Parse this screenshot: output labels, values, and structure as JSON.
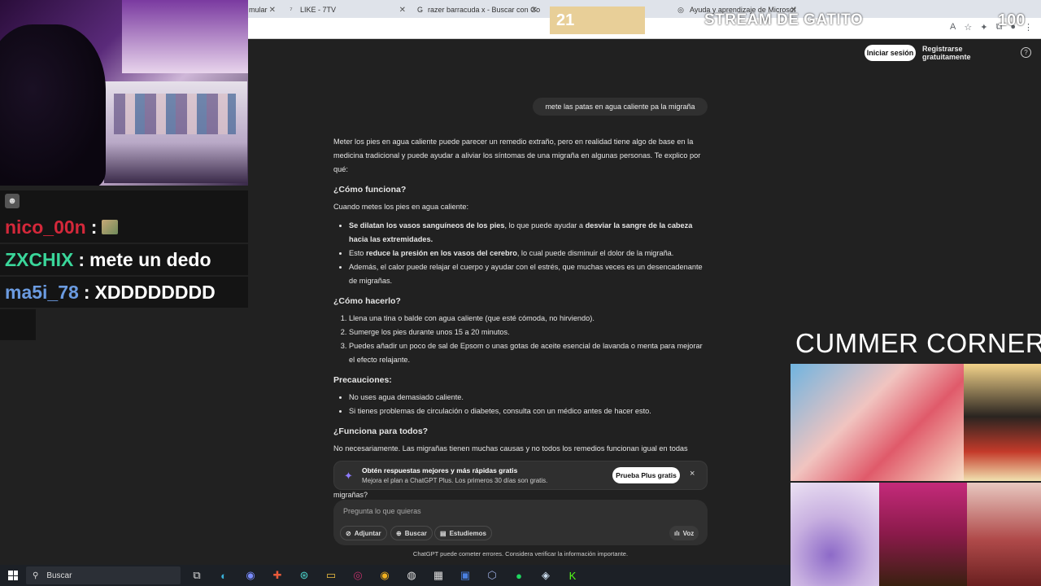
{
  "browser": {
    "tabs": [
      {
        "label": "mular",
        "icon": "",
        "active": false
      },
      {
        "label": "LIKE - 7TV",
        "icon": "7tv-icon",
        "active": false
      },
      {
        "label": "razer barracuda x - Buscar con Go",
        "icon": "google-icon",
        "active": false
      },
      {
        "label": "Ayuda y aprendizaje de Microsof",
        "icon": "globe-icon",
        "active": false
      }
    ]
  },
  "header": {
    "login_label": "Iniciar sesión",
    "register_label": "Registrarse gratuitamente",
    "help_glyph": "?"
  },
  "chat": {
    "user_message": "mete las patas en agua caliente pa la migraña",
    "reply": {
      "intro": "Meter los pies en agua caliente puede parecer un remedio extraño, pero en realidad tiene algo de base en la medicina tradicional y puede ayudar a aliviar los síntomas de una migraña en algunas personas. Te explico por qué:",
      "h1": "¿Cómo funciona?",
      "h1_intro": "Cuando metes los pies en agua caliente:",
      "b1_bold": "Se dilatan los vasos sanguíneos de los pies",
      "b1_mid": ", lo que puede ayudar a ",
      "b1_bold2": "desviar la sangre de la cabeza hacia las extremidades.",
      "b2_pre": "Esto ",
      "b2_bold": "reduce la presión en los vasos del cerebro",
      "b2_post": ", lo cual puede disminuir el dolor de la migraña.",
      "b3": "Además, el calor puede relajar el cuerpo y ayudar con el estrés, que muchas veces es un desencadenante de migrañas.",
      "h2": "¿Cómo hacerlo?",
      "s1": "Llena una tina o balde con agua caliente (que esté cómoda, no hirviendo).",
      "s2": "Sumerge los pies durante unos 15 a 20 minutos.",
      "s3": "Puedes añadir un poco de sal de Epsom o unas gotas de aceite esencial de lavanda o menta para mejorar el efecto relajante.",
      "h3": "Precauciones:",
      "p1": "No uses agua demasiado caliente.",
      "p2": "Si tienes problemas de circulación o diabetes, consulta con un médico antes de hacer esto.",
      "h4": "¿Funciona para todos?",
      "last": "No necesariamente. Las migrañas tienen muchas causas y no todos los remedios funcionan igual en todas",
      "tail": "migrañas?"
    },
    "upsell": {
      "title": "Obtén respuestas mejores y más rápidas gratis",
      "subtitle": "Mejora el plan a ChatGPT Plus. Los primeros 30 días son gratis.",
      "button": "Prueba Plus gratis",
      "close_glyph": "×"
    },
    "composer": {
      "placeholder": "Pregunta lo que quieras",
      "attach": "Adjuntar",
      "search": "Buscar",
      "study": "Estudiemos",
      "voice": "Voz"
    },
    "disclaimer": "ChatGPT puede cometer errores. Considera verificar la información importante."
  },
  "overlay": {
    "counter_left": "21",
    "stream_title": "STREAM DE GATITO",
    "counter_right": "100",
    "corner_title": "CUMMER CORNER",
    "chat_messages": [
      {
        "user": "nico_00n",
        "color": "#d4283a",
        "message": ""
      },
      {
        "user": "ZXCHIX",
        "color": "#3ad69a",
        "message": "mete un dedo"
      },
      {
        "user": "ma5i_78",
        "color": "#6b9be0",
        "message": "XDDDDDDDD"
      }
    ]
  },
  "taskbar": {
    "search_label": "Buscar"
  }
}
